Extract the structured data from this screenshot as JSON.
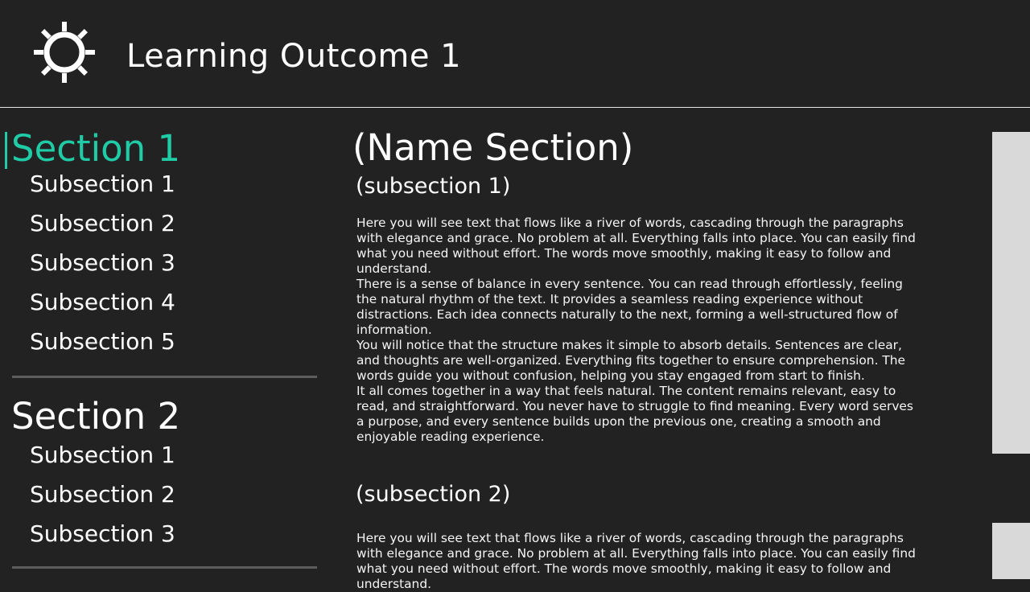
{
  "header": {
    "title": "Learning Outcome 1",
    "settings_icon": "gear-icon"
  },
  "sidebar": {
    "sections": [
      {
        "title": "Section 1",
        "active": true,
        "subsections": [
          "Subsection 1",
          "Subsection 2",
          "Subsection 3",
          "Subsection 4",
          "Subsection 5"
        ]
      },
      {
        "title": "Section 2",
        "active": false,
        "subsections": [
          "Subsection 1",
          "Subsection 2",
          "Subsection 3"
        ]
      }
    ]
  },
  "main": {
    "title": "(Name Section)",
    "subsections": [
      {
        "heading": "(subsection 1)",
        "paragraphs": [
          "Here you will see text that flows like a river of words, cascading through the paragraphs with elegance and grace. No problem at all. Everything falls into place. You can easily find what you need without effort. The words move smoothly, making it easy to follow and understand.",
          "There is a sense of balance in every sentence. You can read through effortlessly, feeling the natural rhythm of the text. It provides a seamless reading experience without distractions. Each idea connects naturally to the next, forming a well-structured flow of information.",
          "You will notice that the structure makes it simple to absorb details. Sentences are clear, and thoughts are well-organized. Everything fits together to ensure comprehension. The words guide you without confusion, helping you stay engaged from start to finish.",
          "It all comes together in a way that feels natural. The content remains relevant, easy to read, and straightforward. You never have to struggle to find meaning. Every word serves a purpose, and every sentence builds upon the previous one, creating a smooth and enjoyable reading experience."
        ]
      },
      {
        "heading": "(subsection 2)",
        "paragraphs": [
          "Here you will see text that flows like a river of words, cascading through the paragraphs with elegance and grace. No problem at all. Everything falls into place. You can easily find what you need without effort. The words move smoothly, making it easy to follow and understand."
        ]
      }
    ]
  },
  "colors": {
    "background": "#222222",
    "accent": "#1fcca6",
    "text": "#ffffff",
    "divider": "#5c5c5c",
    "side_panel": "#d9d9d9"
  }
}
